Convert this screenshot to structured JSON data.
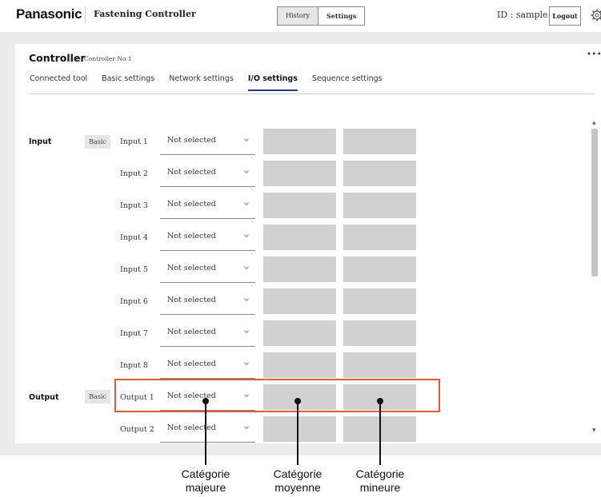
{
  "header": {
    "logo": "Panasonic",
    "app_title": "Fastening Controller",
    "tab_history": "History",
    "tab_settings": "Settings",
    "user_id": "ID : sample",
    "logout": "Logout",
    "gear_icon": "gear-icon"
  },
  "panel": {
    "title": "Controller",
    "subtitle": "Controller No 1",
    "more": "•••",
    "tabs": [
      "Connected tool",
      "Basic settings",
      "Network settings",
      "I/O settings",
      "Sequence settings"
    ],
    "active_tab": "I/O settings"
  },
  "io": {
    "input_label": "Input",
    "output_label": "Output",
    "badge": "Basic",
    "rows": [
      {
        "label": "Input 1",
        "value": "Not selected"
      },
      {
        "label": "Input 2",
        "value": "Not selected"
      },
      {
        "label": "Input 3",
        "value": "Not selected"
      },
      {
        "label": "Input 4",
        "value": "Not selected"
      },
      {
        "label": "Input 5",
        "value": "Not selected"
      },
      {
        "label": "Input 6",
        "value": "Not selected"
      },
      {
        "label": "Input 7",
        "value": "Not selected"
      },
      {
        "label": "Input 8",
        "value": "Not selected"
      },
      {
        "label": "Output 1",
        "value": "Not selected"
      },
      {
        "label": "Output 2",
        "value": "Not selected"
      }
    ]
  },
  "annotations": {
    "major": [
      "Catégorie",
      "majeure"
    ],
    "medium": [
      "Catégorie",
      "moyenne"
    ],
    "minor": [
      "Catégorie",
      "mineure"
    ]
  },
  "colors": {
    "highlight": "#e05a3c",
    "active_tab_underline": "#1f3c88"
  }
}
